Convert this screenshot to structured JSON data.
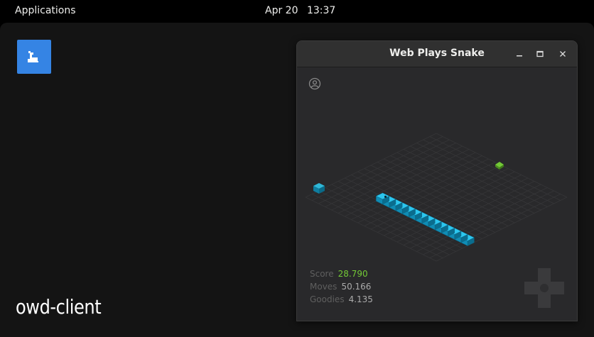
{
  "topbar": {
    "applications": "Applications",
    "date": "Apr 20",
    "time": "13:37"
  },
  "desktop": {
    "launcher_icon": "snake-app-icon",
    "label": "owd-client"
  },
  "window": {
    "title": "Web Plays Snake",
    "controls": {
      "minimize": "minimize-icon",
      "maximize": "maximize-icon",
      "close": "close-icon"
    },
    "account_icon": "account-circle-icon",
    "stats": [
      {
        "label": "Score",
        "value": "28.790"
      },
      {
        "label": "Moves",
        "value": "50.166"
      },
      {
        "label": "Goodies",
        "value": "4.135"
      }
    ],
    "dpad_icon": "directional-pad-icon"
  },
  "colors": {
    "accent_green": "#73c936",
    "snake_blue": "#1cb4e0",
    "launcher_blue": "#3584e4"
  }
}
